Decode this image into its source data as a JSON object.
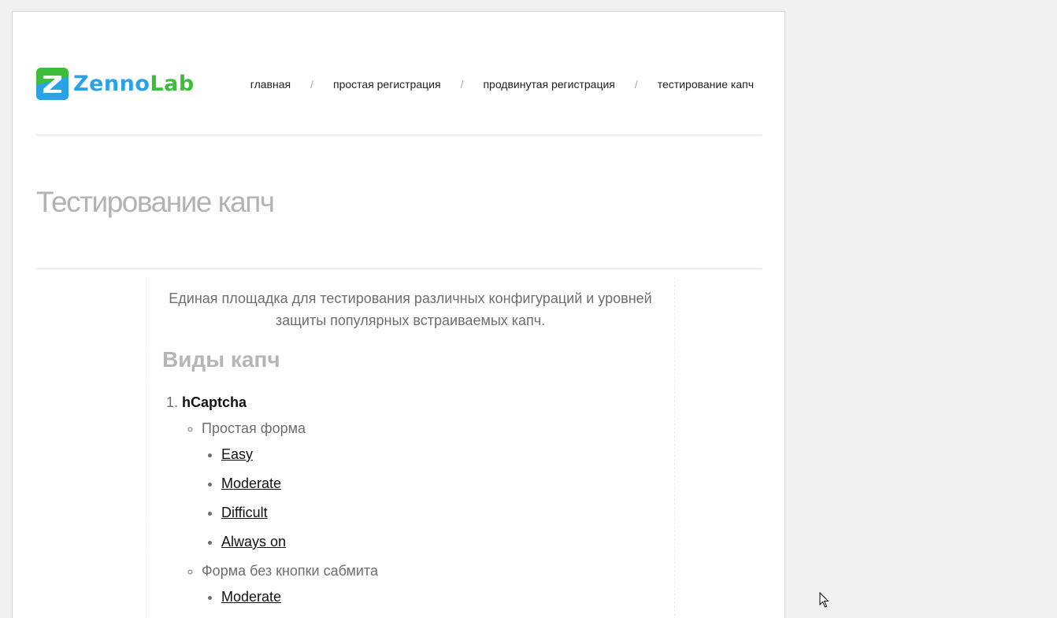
{
  "logo": {
    "text_part1": "Zenno",
    "text_part2": "Lab",
    "icon": "zennolab-logo-icon",
    "colors": {
      "blue": "#2aa3e6",
      "green": "#3cbd3c"
    }
  },
  "nav": {
    "items": [
      {
        "label": "главная"
      },
      {
        "label": "простая регистрация"
      },
      {
        "label": "продвинутая регистрация"
      },
      {
        "label": "тестирование капч"
      }
    ],
    "separator": "/"
  },
  "page": {
    "title": "Тестирование капч",
    "intro": "Единая площадка для тестирования различных конфигураций и уровней защиты популярных встраиваемых капч.",
    "section_title": "Виды капч"
  },
  "captchas": [
    {
      "name": "hCaptcha",
      "forms": [
        {
          "label": "Простая форма",
          "levels": [
            "Easy",
            "Moderate",
            "Difficult",
            "Always on"
          ]
        },
        {
          "label": "Форма без кнопки сабмита",
          "levels": [
            "Moderate"
          ]
        }
      ]
    }
  ]
}
